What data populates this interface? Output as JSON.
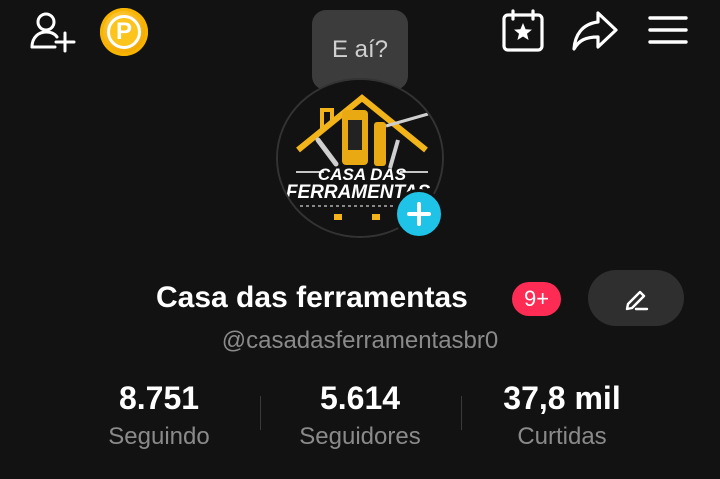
{
  "header": {
    "add_user_icon": "add-user-icon",
    "coin_letter": "P",
    "calendar_icon": "calendar-star-icon",
    "share_icon": "share-arrow-icon",
    "menu_icon": "hamburger-menu-icon"
  },
  "tooltip": {
    "text": "E aí?"
  },
  "profile": {
    "avatar_text_1": "CASA DAS",
    "avatar_text_2": "FERRAMENTAS",
    "name": "Casa das ferramentas",
    "notification_badge": "9+",
    "handle": "@casadasferramentasbr0"
  },
  "stats": [
    {
      "value": "8.751",
      "label": "Seguindo"
    },
    {
      "value": "5.614",
      "label": "Seguidores"
    },
    {
      "value": "37,8 mil",
      "label": "Curtidas"
    }
  ],
  "colors": {
    "background": "#121212",
    "accent_red": "#fe2c55",
    "accent_cyan": "#20c3e8",
    "coin_gold": "#f7b500"
  }
}
